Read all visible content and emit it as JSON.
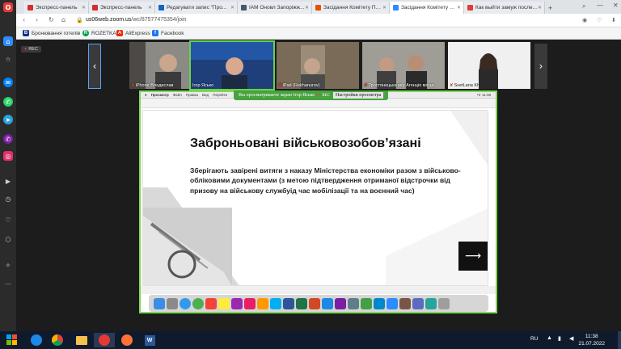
{
  "browser": {
    "tabs": [
      {
        "label": "Экспресс-панель",
        "color": "#d32f2f",
        "active": false
      },
      {
        "label": "Экспресс-панель",
        "color": "#d32f2f",
        "active": false
      },
      {
        "label": "Редагувати запис \"Про...",
        "color": "#1565c0",
        "active": false
      },
      {
        "label": "ІАМ Оновл Запоріжж...",
        "color": "#455a64",
        "active": false
      },
      {
        "label": "Засідання Комітету ПП...",
        "color": "#e65100",
        "active": false
      },
      {
        "label": "Засідання Комітету МО...",
        "color": "#2d8cff",
        "active": true
      },
      {
        "label": "Как выйти замуж после...",
        "color": "#e53935",
        "active": false
      }
    ],
    "url_host": "us06web.zoom.us",
    "url_path": "/wc/87577475354/join",
    "bookmarks": [
      {
        "label": "Бронювання готелів",
        "icon": "B",
        "color": "#003580"
      },
      {
        "label": "ROZETKA",
        "icon": "R",
        "color": "#00a046"
      },
      {
        "label": "AliExpress",
        "icon": "A",
        "color": "#e62e04"
      },
      {
        "label": "Facebook",
        "icon": "f",
        "color": "#1877f2"
      }
    ]
  },
  "zoom": {
    "rec_label": "REC",
    "participants": [
      {
        "name": "iPhone Владислав",
        "muted": true
      },
      {
        "name": "Ігор Ясько",
        "muted": false
      },
      {
        "name": "iPad (Rekhanurov)",
        "muted": true
      },
      {
        "name": "Тростянецька м/р Агенція місце...",
        "muted": true
      },
      {
        "name": "SvetLana Kh",
        "muted": true
      }
    ],
    "share_banner": "Вы просматриваете экран Ігор Ясько",
    "share_rec": "REC",
    "share_settings": "Настройки просмотра"
  },
  "slide": {
    "title": "Заброньовані військовозобов’язані",
    "body": "Зберігають завірені витяги з наказу Міністерства економіки разом з військово-обліковими  документами (з метою підтвердження отриманої відстрочки від призову на військову службуід час мобілізації та на воєнний час)",
    "next_arrow": "⟶"
  },
  "mac": {
    "app": "Просмотр",
    "menus": [
      "Файл",
      "Правка",
      "Вид",
      "Перейти"
    ],
    "time": "Чт 11:38"
  },
  "taskbar": {
    "lang": "RU",
    "time": "11:38",
    "date": "21.07.2022"
  },
  "colors": {
    "zoom_blue": "#2d8cff",
    "share_green": "#48a23f",
    "speaker_outline": "#6ad14a"
  }
}
